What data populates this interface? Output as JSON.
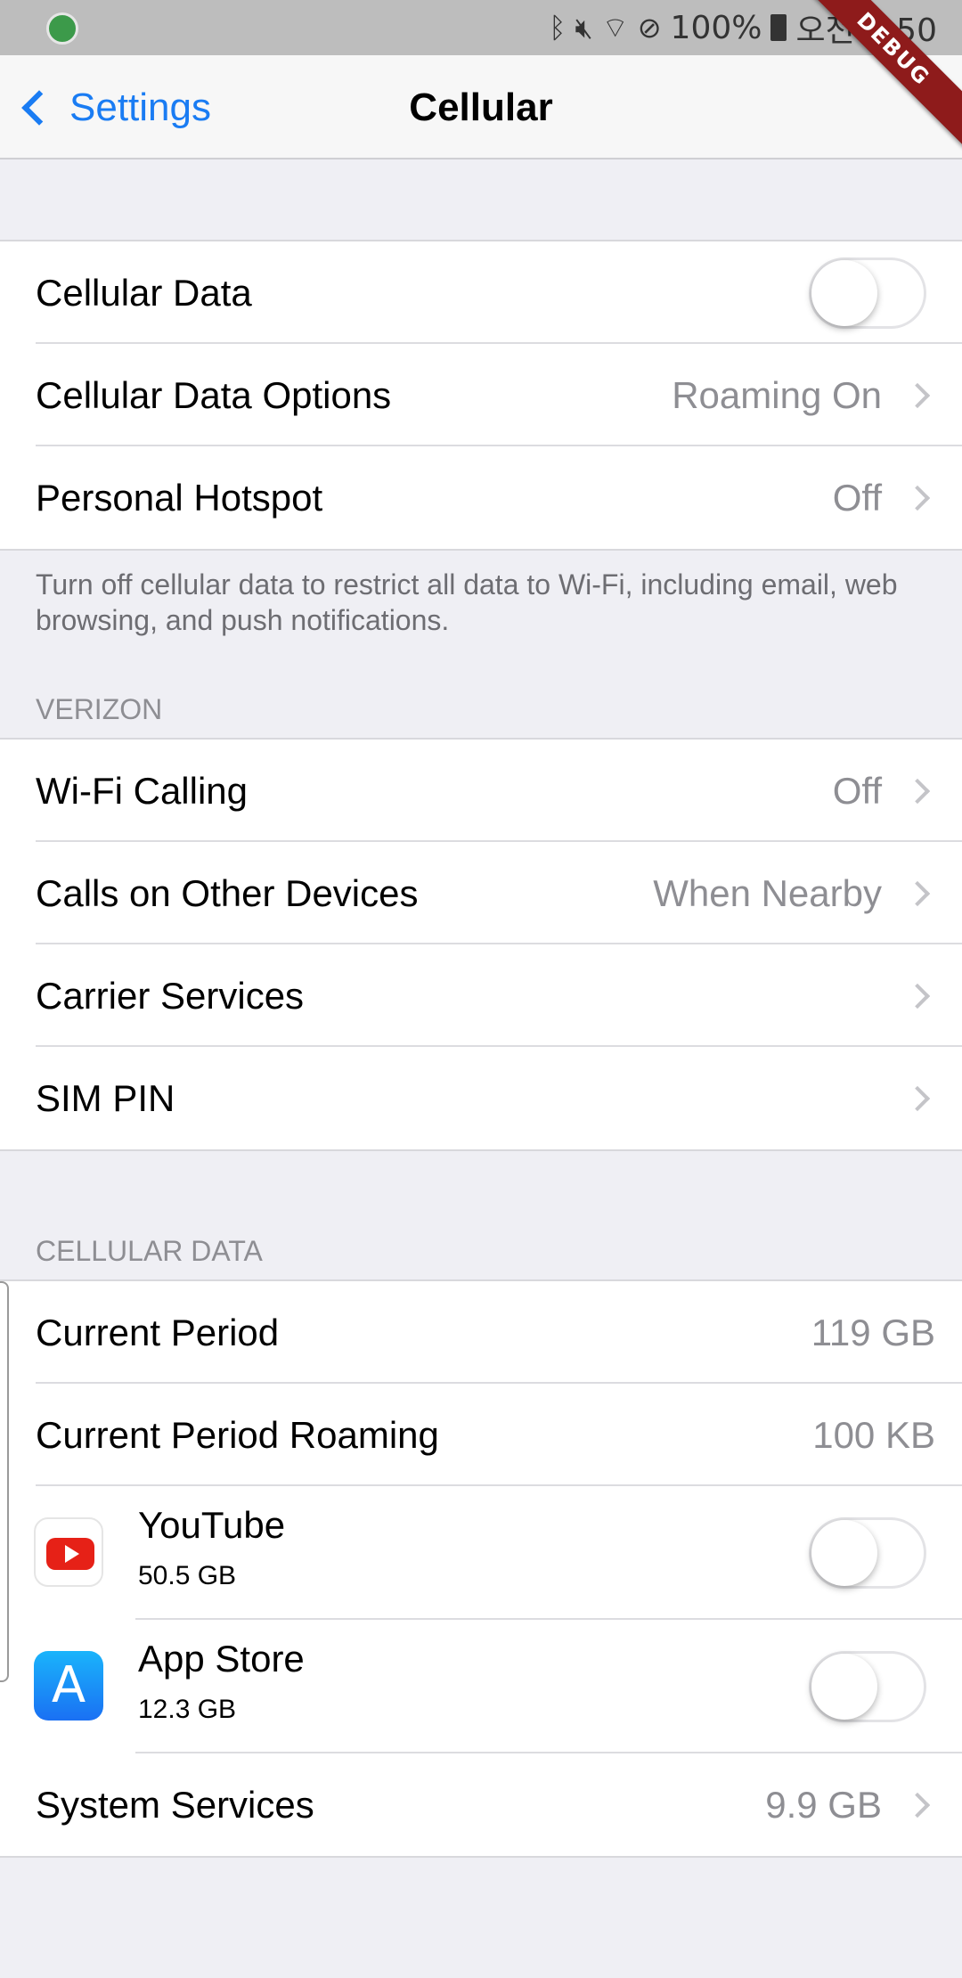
{
  "status_bar": {
    "battery": "100%",
    "time": "오전 1:50"
  },
  "debug_badge": "DEBUG",
  "nav": {
    "back_label": "Settings",
    "title": "Cellular"
  },
  "group1": {
    "cellular_data": {
      "label": "Cellular Data",
      "toggle_on": false
    },
    "cellular_data_options": {
      "label": "Cellular Data Options",
      "value": "Roaming On"
    },
    "personal_hotspot": {
      "label": "Personal Hotspot",
      "value": "Off"
    }
  },
  "note": "Turn off cellular data to restrict all data to Wi-Fi, including email, web browsing, and push notifications.",
  "verizon": {
    "header": "VERIZON",
    "wifi_calling": {
      "label": "Wi-Fi Calling",
      "value": "Off"
    },
    "calls_other_devices": {
      "label": "Calls on Other Devices",
      "value": "When Nearby"
    },
    "carrier_services": {
      "label": "Carrier Services"
    },
    "sim_pin": {
      "label": "SIM PIN"
    }
  },
  "cellular_data_section": {
    "header": "CELLULAR DATA",
    "current_period": {
      "label": "Current Period",
      "value": "119 GB"
    },
    "current_period_roaming": {
      "label": "Current Period Roaming",
      "value": "100 KB"
    },
    "apps": [
      {
        "name": "YouTube",
        "size": "50.5 GB",
        "icon": "youtube-icon",
        "toggle_on": false
      },
      {
        "name": "App Store",
        "size": "12.3 GB",
        "icon": "app-store-icon",
        "toggle_on": false
      }
    ],
    "system_services": {
      "label": "System Services",
      "value": "9.9 GB"
    }
  },
  "colors": {
    "accent": "#1a7cf3",
    "background": "#efeff4",
    "secondary_text": "#8e8e93"
  }
}
